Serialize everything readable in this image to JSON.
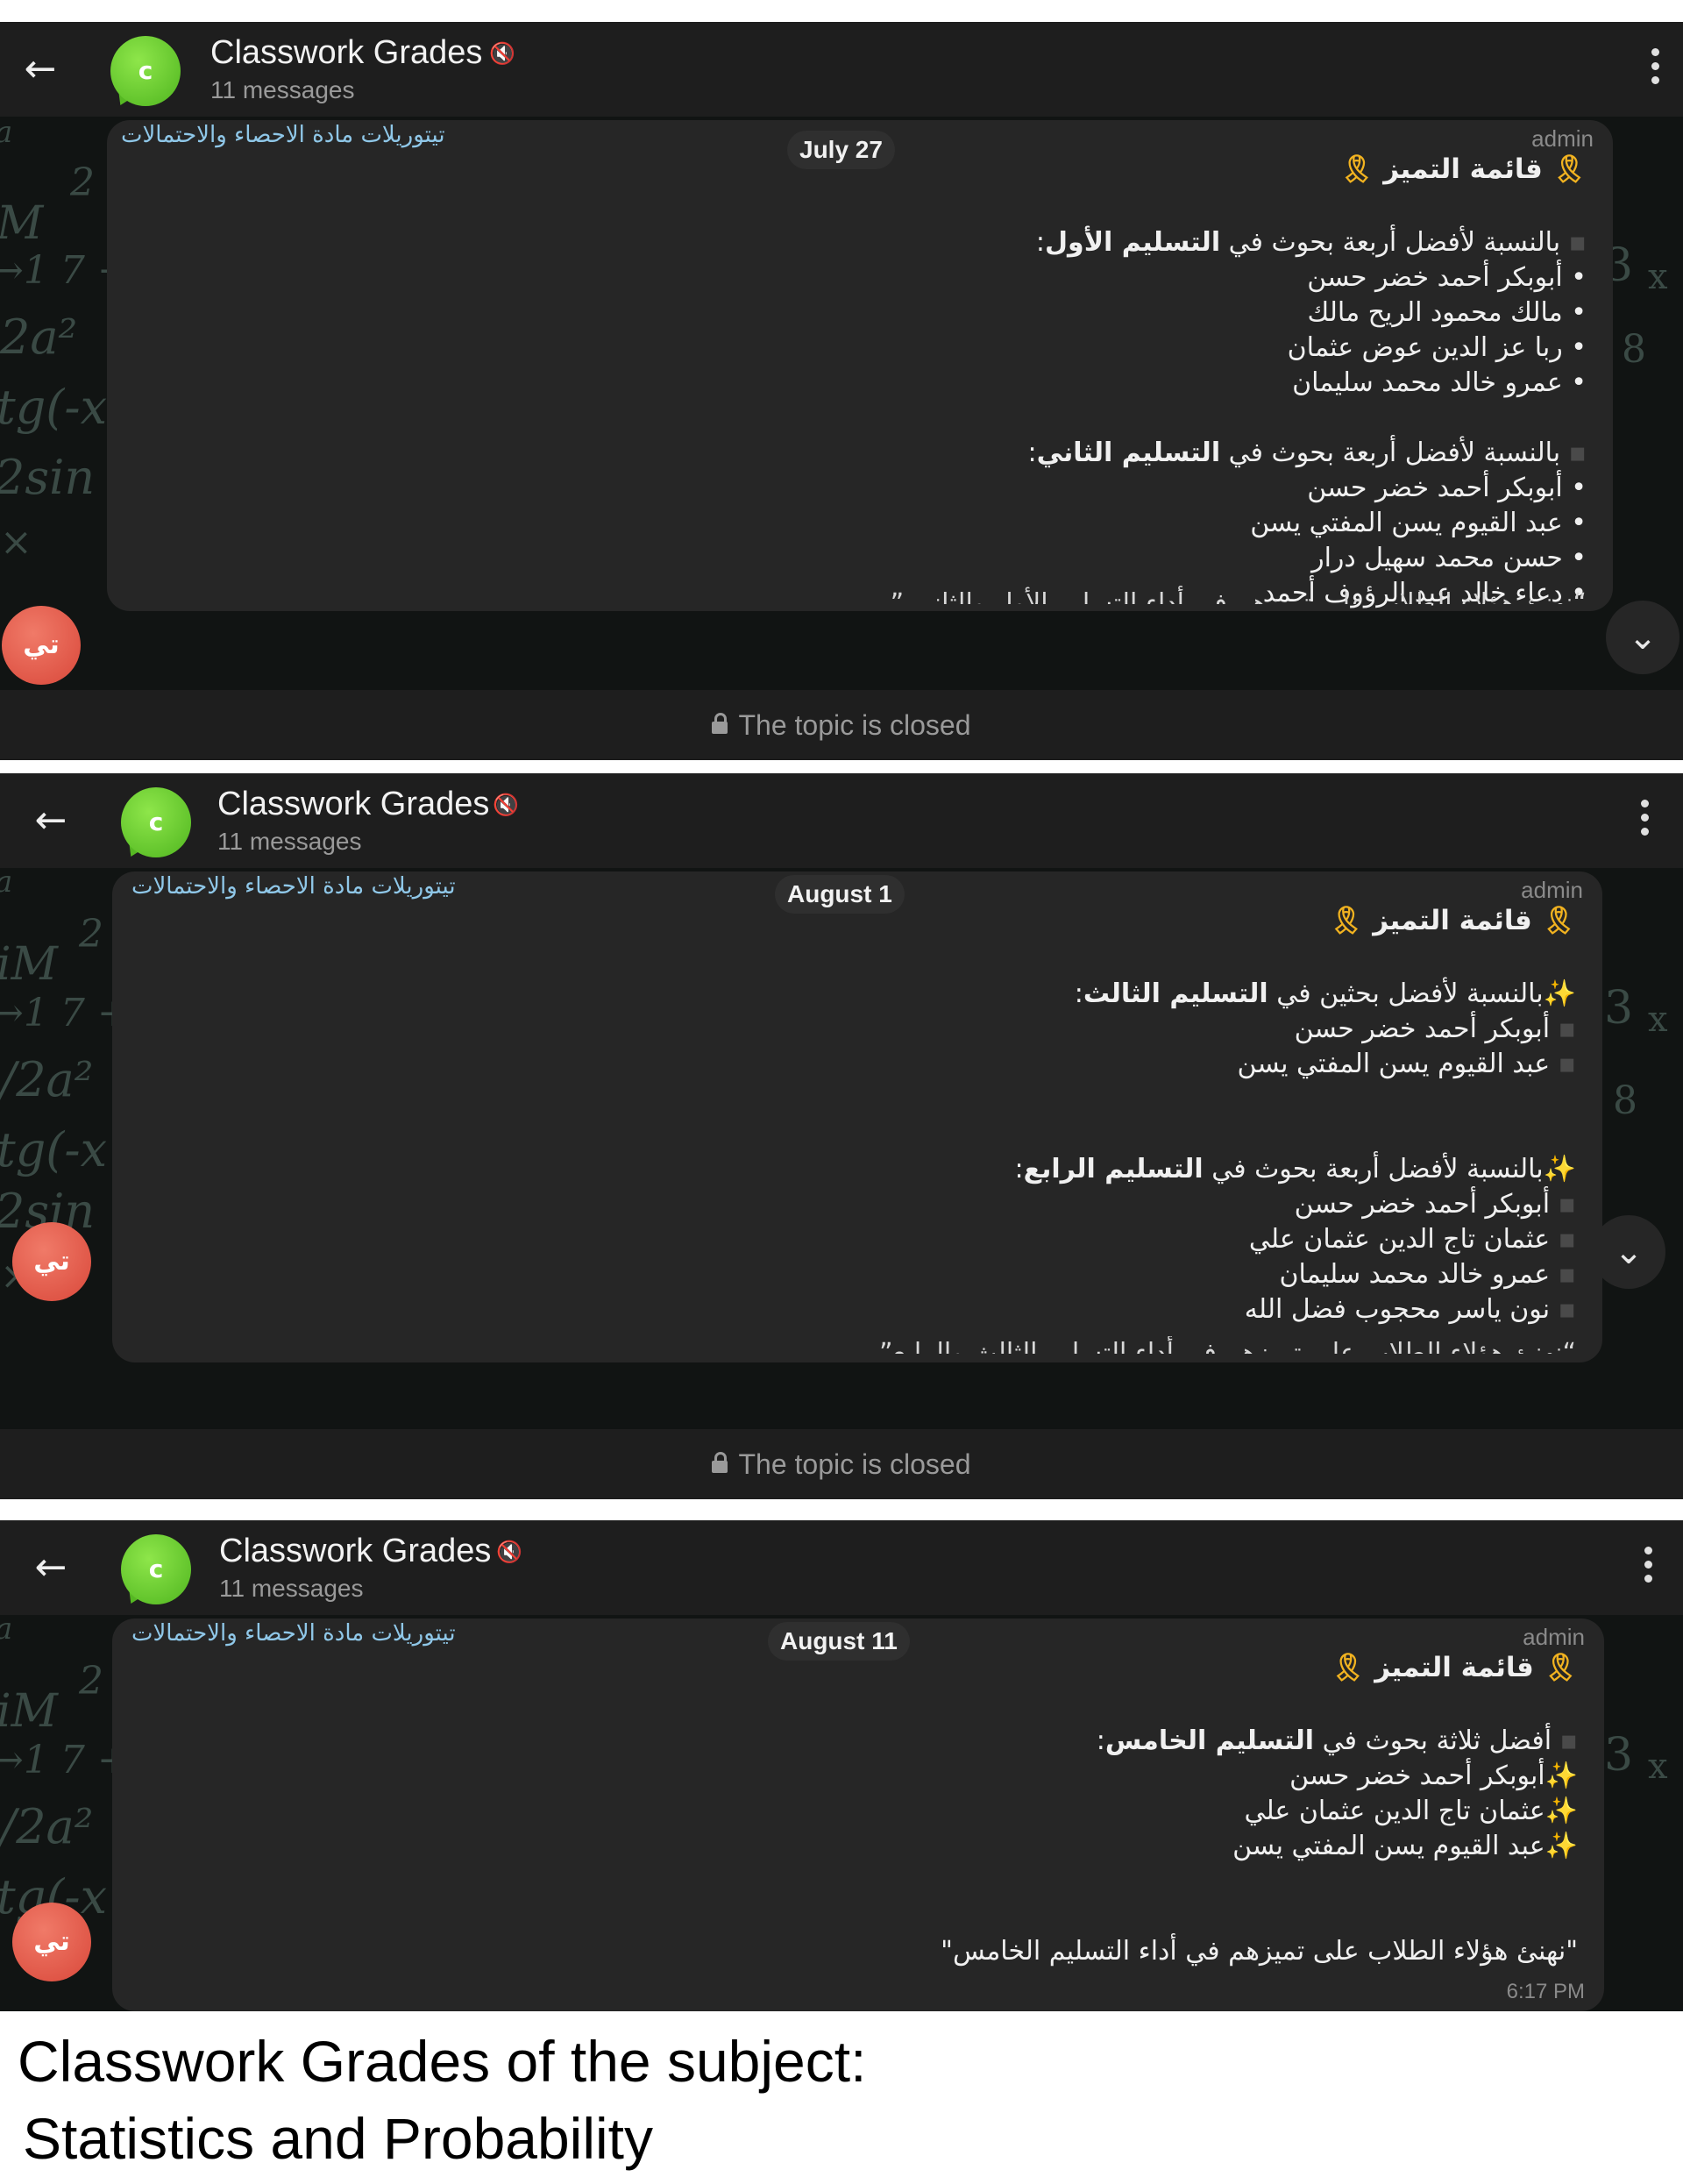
{
  "screens": [
    {
      "header": {
        "title": "Classwork Grades",
        "subtitle": "11 messages",
        "avatar_letter": "c"
      },
      "topic_link": "تيتوريلات مادة الاحصاء والاحتمالات",
      "date": "July 27",
      "sender": "admin",
      "message": {
        "title": "قائمة التميز",
        "sections": [
          {
            "lead": "بالنسبة لأفضل أربعة بحوث في",
            "bold": "التسليم الأول",
            "colon": ":",
            "items": [
              "أبوبكر أحمد خضر حسن",
              "مالك محمود الريح مالك",
              "ربا عز الدين عوض عثمان",
              "عمرو خالد محمد سليمان"
            ]
          },
          {
            "lead": "بالنسبة لأفضل أربعة بحوث في",
            "bold": "التسليم الثاني",
            "colon": ":",
            "items": [
              "أبوبكر أحمد خضر حسن",
              "عبد القيوم يسن المفتي يسن",
              "حسن محمد سهيل درار",
              "دعاء خالد عبد الرؤوف أحمد"
            ]
          }
        ],
        "footer_partial": "“نهنئ هؤلاء الطلاب على تميزهم في أداء التسليم الأول والثاني ”"
      },
      "user_avatar": "تي",
      "closed_text": "The topic is closed"
    },
    {
      "header": {
        "title": "Classwork Grades",
        "subtitle": "11 messages",
        "avatar_letter": "c"
      },
      "topic_link": "تيتوريلات مادة الاحصاء والاحتمالات",
      "date": "August 1",
      "sender": "admin",
      "message": {
        "title": "قائمة التميز",
        "sections": [
          {
            "lead": "بالنسبة لأفضل بحثين في",
            "bold": "التسليم الثالث",
            "colon": ":",
            "items": [
              "أبوبكر أحمد خضر حسن",
              "عبد القيوم يسن المفتي يسن"
            ]
          },
          {
            "lead": "بالنسبة لأفضل أربعة بحوث في",
            "bold": "التسليم الرابع",
            "colon": ":",
            "items": [
              "أبوبكر أحمد خضر حسن",
              "عثمان تاج الدين عثمان علي",
              "عمرو خالد محمد سليمان",
              "نون ياسر محجوب فضل الله"
            ]
          }
        ],
        "footer_partial": "“نهنئ هؤلاء الطلاب على تميزهم في أداء التسليم الثالث والرابع”"
      },
      "user_avatar": "تي",
      "closed_text": "The topic is closed"
    },
    {
      "header": {
        "title": "Classwork Grades",
        "subtitle": "11 messages",
        "avatar_letter": "c"
      },
      "topic_link": "تيتوريلات مادة الاحصاء والاحتمالات",
      "date": "August 11",
      "sender": "admin",
      "message": {
        "title": "قائمة التميز",
        "sections": [
          {
            "lead": "أفضل ثلاثة بحوث في",
            "bold": "التسليم الخامس",
            "colon": ":",
            "items": [
              "أبوبكر أحمد خضر حسن",
              "عثمان تاج الدين عثمان علي",
              "عبد القيوم يسن المفتي يسن"
            ]
          }
        ],
        "footer": "\"نهنئ هؤلاء الطلاب على تميزهم في أداء التسليم الخامس\""
      },
      "time": "6:17 PM",
      "user_avatar": "تي"
    }
  ],
  "caption": {
    "line1": "Classwork Grades of the subject:",
    "line2": "Statistics and Probability"
  },
  "icons": {
    "back": "arrow-left-icon",
    "more": "more-vertical-icon",
    "mute": "muted-icon",
    "scroll": "chevron-down-icon",
    "lock": "lock-icon",
    "ribbon": "ribbon-emoji",
    "sparkles": "sparkles-emoji",
    "square": "black-square-emoji"
  },
  "colors": {
    "accent_green": "#56b823",
    "link_blue": "#8fc7e8",
    "avatar_red": "#d9483a",
    "ribbon_gold": "#f2b320"
  }
}
